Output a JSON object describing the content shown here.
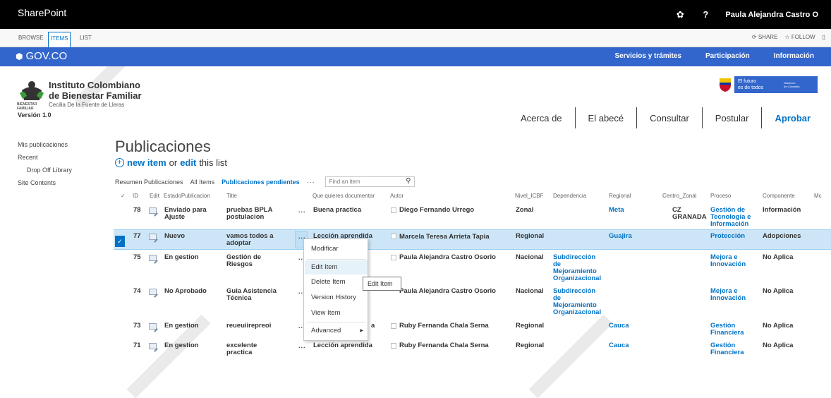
{
  "suitebar": {
    "brand": "SharePoint",
    "gear": "gear-icon",
    "help": "?",
    "user": "Paula Alejandra Castro O"
  },
  "ribbon": {
    "browse": "BROWSE",
    "items": "ITEMS",
    "list": "LIST",
    "share": "SHARE",
    "follow": "FOLLOW"
  },
  "gov": {
    "logo": "GOV.CO",
    "nav": [
      "Servicios y trámites",
      "Participación",
      "Información"
    ],
    "color": "#3366cc"
  },
  "institute": {
    "name_line1": "Instituto Colombiano",
    "name_line2": "de Bienestar Familiar",
    "subtitle": "Cecilia De la Fuente de Lleras",
    "small_logo_text1": "BIENESTAR",
    "small_logo_text2": "FAMILIAR",
    "version": "Versión 1.0",
    "futuro_line1": "El futuro",
    "futuro_line2": "es de todos",
    "gob_line1": "Gobierno",
    "gob_line2": "de Colombia"
  },
  "topnav": [
    "Acerca de",
    "El abecé",
    "Consultar",
    "Postular",
    "Aprobar"
  ],
  "quicklaunch": [
    "Mis publicaciones",
    "Recent",
    "Drop Off Library",
    "Site Contents"
  ],
  "page": {
    "title": "Publicaciones",
    "new_item": "new item",
    "or": "or",
    "edit": "edit",
    "this_list": "this list",
    "views": [
      "Resumen Publicaciones",
      "All Items",
      "Publicaciones pendientes"
    ],
    "view_more": "···",
    "find_placeholder": "Find an item"
  },
  "columns": [
    "✓",
    "ID",
    "Edit",
    "EstadoPublicacion",
    "Title",
    "Que quieres documentar",
    "Autor",
    "Nivel_ICBF",
    "Dependencia",
    "Regional",
    "Centro_Zonal",
    "Proceso",
    "Componente",
    "Mc"
  ],
  "rows": [
    {
      "id": "78",
      "estado": "Enviado para",
      "estado2": "Ajuste",
      "title": "pruebas BPLA",
      "title2": "postulacion",
      "que": "Buena practica",
      "autor": "Diego Fernando Urrego",
      "nivel": "Zonal",
      "dep": [
        "",
        "",
        "",
        ""
      ],
      "regional": "Meta",
      "cz": "CZ",
      "cz2": "GRANADA",
      "proceso": [
        "Gestión de",
        "Tecnología e",
        "Información"
      ],
      "componente": "Información"
    },
    {
      "id": "77",
      "estado": "Nuevo",
      "estado2": "",
      "title": "vamos todos a",
      "title2": "adoptar",
      "que": "Lección aprendida",
      "autor": "Marcela Teresa Arrieta Tapia",
      "nivel": "Regional",
      "dep": [
        "",
        "",
        "",
        ""
      ],
      "regional": "Guajira",
      "cz": "",
      "cz2": "",
      "proceso": [
        "Protección",
        "",
        ""
      ],
      "componente": "Adopciones"
    },
    {
      "id": "75",
      "estado": "En gestion",
      "estado2": "",
      "title": "Gestión de",
      "title2": "Riesgos",
      "que": "",
      "autor": "Paula Alejandra Castro Osorio",
      "nivel": "Nacional",
      "dep": [
        "Subdirección",
        "de",
        "Mejoramiento",
        "Organizacional"
      ],
      "regional": "",
      "cz": "",
      "cz2": "",
      "proceso": [
        "Mejora e",
        "Innovación",
        ""
      ],
      "componente": "No Aplica"
    },
    {
      "id": "74",
      "estado": "No Aprobado",
      "estado2": "",
      "title": "Guia Asistencia",
      "title2": "Técnica",
      "que": "",
      "autor": "Paula Alejandra Castro Osorio",
      "nivel": "Nacional",
      "dep": [
        "Subdirección",
        "de",
        "Mejoramiento",
        "Organizacional"
      ],
      "regional": "",
      "cz": "",
      "cz2": "",
      "proceso": [
        "Mejora e",
        "Innovación",
        ""
      ],
      "componente": "No Aplica"
    },
    {
      "id": "73",
      "estado": "En gestion",
      "estado2": "",
      "title": "reueuiirepreoi",
      "title2": "",
      "que": "a",
      "autor": "Ruby Fernanda Chala Serna",
      "nivel": "Regional",
      "dep": [
        "",
        "",
        "",
        ""
      ],
      "regional": "Cauca",
      "cz": "",
      "cz2": "",
      "proceso": [
        "Gestión",
        "Financiera",
        ""
      ],
      "componente": "No Aplica"
    },
    {
      "id": "71",
      "estado": "En gestion",
      "estado2": "",
      "title": "excelente",
      "title2": "practica",
      "que": "Lección aprendida",
      "autor": "Ruby Fernanda Chala Serna",
      "nivel": "Regional",
      "dep": [
        "",
        "",
        "",
        ""
      ],
      "regional": "Cauca",
      "cz": "",
      "cz2": "",
      "proceso": [
        "Gestión",
        "Financiera",
        ""
      ],
      "componente": "No Aplica"
    }
  ],
  "menu": {
    "items": [
      "Modificar",
      "Edit Item",
      "Delete Item",
      "Version History",
      "View Item",
      "Advanced"
    ],
    "tooltip": "Edit Item"
  }
}
